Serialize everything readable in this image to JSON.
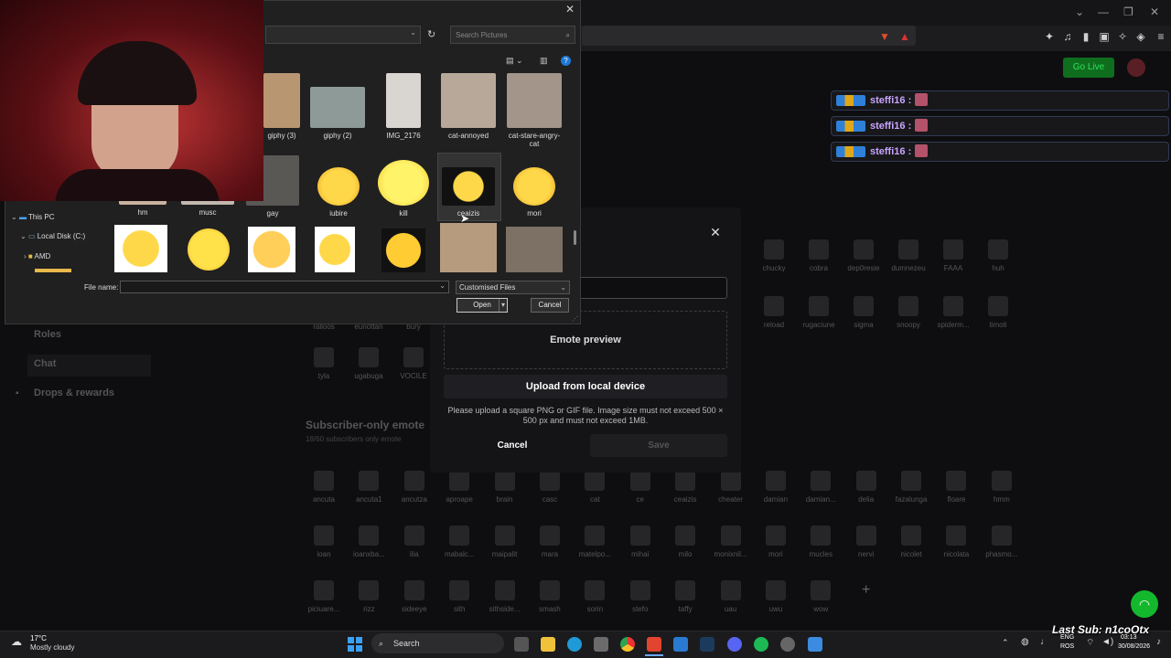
{
  "browser": {
    "window_controls": [
      "⌄",
      "—",
      "❐",
      "✕"
    ]
  },
  "twitch": {
    "go_live": "Go Live",
    "chat_lines": [
      {
        "user": "steffi16 :"
      },
      {
        "user": "steffi16 :"
      },
      {
        "user": "steffi16 :"
      }
    ],
    "sidebar": [
      "Roles",
      "Chat",
      "Drops & rewards"
    ],
    "emotes_row1": [
      "chucky",
      "cobra",
      "dep0resie",
      "dumnezeu",
      "FAAA",
      "huh"
    ],
    "emotes_row2": [
      "reload",
      "rugaciune",
      "sigma",
      "snoopy",
      "spiderm...",
      "timoti"
    ],
    "emotes_row3": [
      "tyla",
      "ugabuga",
      "VOCILE"
    ],
    "emotes_row3_top": [
      "ralloos",
      "euriottan",
      "bury"
    ],
    "subscriber_title": "Subscriber-only emote",
    "subscriber_count": "18/60 subscribers only emote",
    "sub_row1": [
      "ancuta",
      "ancuta1",
      "ancutza",
      "aproape",
      "brain",
      "casc",
      "cat",
      "ce",
      "ceaizis",
      "cheater",
      "damian",
      "damian...",
      "delia",
      "fazalunga",
      "floare",
      "hmm"
    ],
    "sub_row2": [
      "ioan",
      "ioanxba...",
      "ilia",
      "mabalc...",
      "maipalit",
      "mara",
      "matelpo...",
      "mihai",
      "milo",
      "monixnil...",
      "mori",
      "mucles",
      "nervi",
      "nicolet",
      "nicolata",
      "phasmo..."
    ],
    "sub_row3": [
      "piciuare...",
      "rizz",
      "sideeye",
      "sith",
      "sithside...",
      "smash",
      "sorin",
      "stefo",
      "taffy",
      "uau",
      "uwu",
      "wow"
    ]
  },
  "modal": {
    "close": "✕",
    "emote_preview": "Emote preview",
    "upload_local": "Upload from local device",
    "help_text": "Please upload a square PNG or GIF file. Image size must not exceed 500 × 500 px and must not exceed 1MB.",
    "cancel": "Cancel",
    "save": "Save"
  },
  "file_dialog": {
    "close": "✕",
    "search_placeholder": "Search Pictures",
    "tree": [
      "This PC",
      "Local Disk (C:)",
      "AMD"
    ],
    "row1": [
      "giphy (3)",
      "giphy (2)",
      "IMG_2176",
      "cat-annoyed",
      "cat-stare-angry-cat"
    ],
    "row2": [
      "hm",
      "musc",
      "gay",
      "iubire",
      "kill",
      "ceaizis",
      "mori"
    ],
    "file_name_label": "File name:",
    "file_type": "Customised Files",
    "open": "Open",
    "cancel": "Cancel"
  },
  "taskbar": {
    "temp": "17°C",
    "weather": "Mostly cloudy",
    "search": "Search",
    "lang_top": "ENG",
    "lang_bottom": "ROS",
    "time": "03:13",
    "date": "30/08/2026",
    "last_sub": "Last Sub: n1coOtx"
  }
}
